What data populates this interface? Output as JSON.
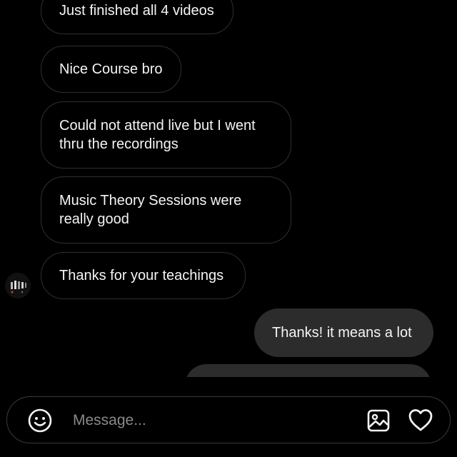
{
  "thread": {
    "messages": [
      {
        "direction": "incoming",
        "text": "Just finished all 4 videos"
      },
      {
        "direction": "incoming",
        "text": "Nice Course bro"
      },
      {
        "direction": "incoming",
        "text": "Could not attend live but I went thru the recordings"
      },
      {
        "direction": "incoming",
        "text": "Music Theory Sessions were really good"
      },
      {
        "direction": "incoming",
        "text": "Thanks for your teachings"
      },
      {
        "direction": "outgoing",
        "text": "Thanks! it means a lot"
      },
      {
        "direction": "outgoing",
        "text": ""
      }
    ],
    "sender_avatar_icon": "avatar-image"
  },
  "composer": {
    "placeholder": "Message...",
    "value": "",
    "left_icon": "emoji-icon",
    "right_icons": [
      "image-icon",
      "heart-icon"
    ]
  },
  "colors": {
    "background": "#000000",
    "incoming_border": "#2f2f2f",
    "outgoing_fill": "#2c2c2c",
    "text": "#f5f5f5",
    "placeholder": "#8a8a8a"
  }
}
